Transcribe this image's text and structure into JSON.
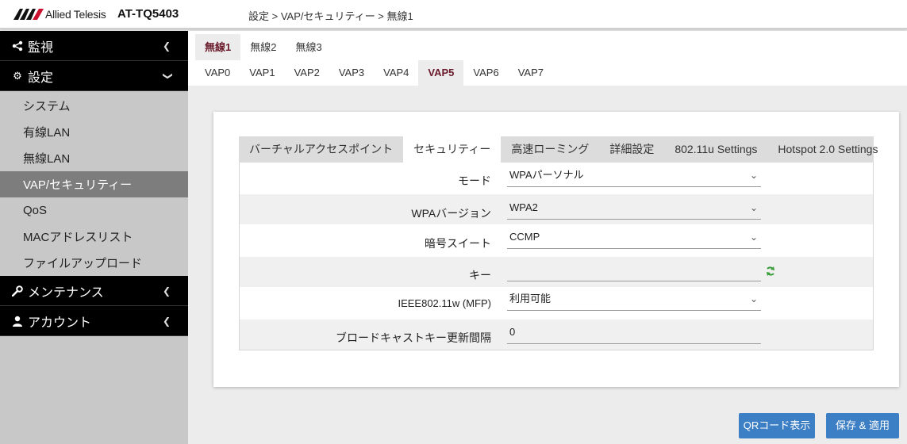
{
  "header": {
    "brand": "Allied Telesis",
    "model": "AT-TQ5403",
    "breadcrumb": "設定 > VAP/セキュリティー > 無線1"
  },
  "sidebar": {
    "sections": [
      {
        "label": "監視",
        "icon": "share-icon"
      },
      {
        "label": "設定",
        "icon": "gear-icon"
      },
      {
        "label": "メンテナンス",
        "icon": "wrench-icon"
      },
      {
        "label": "アカウント",
        "icon": "user-icon"
      }
    ],
    "items": [
      {
        "label": "システム"
      },
      {
        "label": "有線LAN"
      },
      {
        "label": "無線LAN"
      },
      {
        "label": "VAP/セキュリティー",
        "active": true
      },
      {
        "label": "QoS"
      },
      {
        "label": "MACアドレスリスト"
      },
      {
        "label": "ファイルアップロード"
      }
    ]
  },
  "radio_tabs": [
    "無線1",
    "無線2",
    "無線3"
  ],
  "vap_tabs": [
    "VAP0",
    "VAP1",
    "VAP2",
    "VAP3",
    "VAP4",
    "VAP5",
    "VAP6",
    "VAP7"
  ],
  "section_tabs": [
    "バーチャルアクセスポイント",
    "セキュリティー",
    "高速ローミング",
    "詳細設定",
    "802.11u Settings",
    "Hotspot 2.0 Settings"
  ],
  "form": {
    "mode": {
      "label": "モード",
      "value": "WPAパーソナル"
    },
    "wpa_version": {
      "label": "WPAバージョン",
      "value": "WPA2"
    },
    "cipher": {
      "label": "暗号スイート",
      "value": "CCMP"
    },
    "key": {
      "label": "キー",
      "value": ""
    },
    "mfp": {
      "label": "IEEE802.11w (MFP)",
      "value": "利用可能"
    },
    "broadcast_interval": {
      "label": "ブロードキャストキー更新間隔",
      "value": "0"
    }
  },
  "buttons": {
    "qr": "QRコード表示",
    "save": "保存 & 適用"
  },
  "colors": {
    "accent": "#6a1a2a",
    "button": "#3d7fc4",
    "sidebar_active": "#7d7d7d"
  }
}
